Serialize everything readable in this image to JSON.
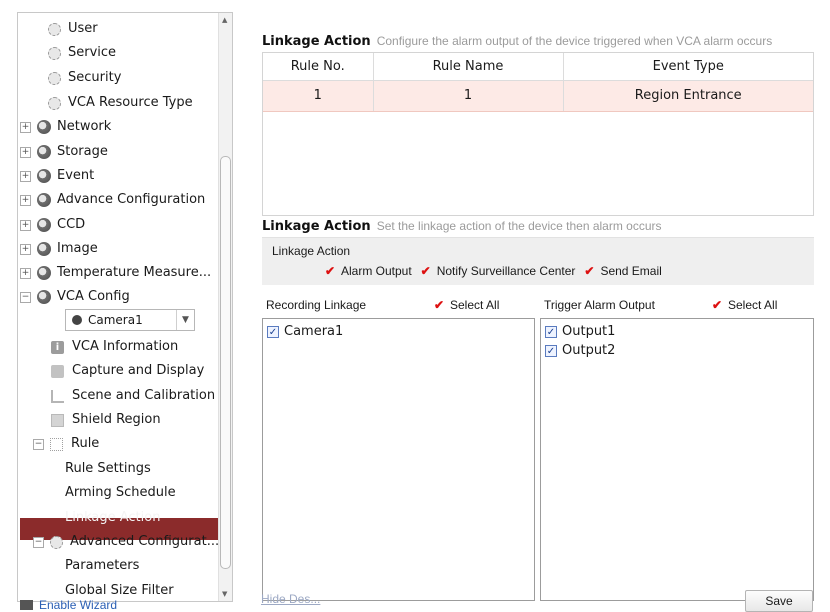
{
  "tree": {
    "items": [
      {
        "label": "User",
        "icon": "gear-icon"
      },
      {
        "label": "Service",
        "icon": "gear-icon"
      },
      {
        "label": "Security",
        "icon": "gear-icon"
      },
      {
        "label": "VCA Resource Type",
        "icon": "gear-icon"
      },
      {
        "label": "Network",
        "icon": "globe-icon",
        "expander": "+"
      },
      {
        "label": "Storage",
        "icon": "globe-icon",
        "expander": "+"
      },
      {
        "label": "Event",
        "icon": "globe-icon",
        "expander": "+"
      },
      {
        "label": "Advance Configuration",
        "icon": "globe-icon",
        "expander": "+"
      },
      {
        "label": "CCD",
        "icon": "globe-icon",
        "expander": "+"
      },
      {
        "label": "Image",
        "icon": "globe-icon",
        "expander": "+"
      },
      {
        "label": "Temperature Measure...",
        "icon": "globe-icon",
        "expander": "+"
      },
      {
        "label": "VCA Config",
        "icon": "globe-icon",
        "expander": "−"
      }
    ],
    "camera_select": {
      "value": "Camera1"
    },
    "sub_items": [
      {
        "label": "VCA Information"
      },
      {
        "label": "Capture and Display"
      },
      {
        "label": "Scene and Calibration"
      },
      {
        "label": "Shield Region"
      }
    ],
    "rule": {
      "label": "Rule",
      "expander": "−"
    },
    "rule_children": [
      {
        "label": "Rule Settings"
      },
      {
        "label": "Arming Schedule"
      },
      {
        "label": "Linkage Action",
        "selected": true
      }
    ],
    "advanced": {
      "label": "Advanced Configurat...",
      "expander": "−"
    },
    "advanced_children": [
      {
        "label": "Parameters"
      },
      {
        "label": "Global Size Filter"
      }
    ],
    "selected_color": "#8b2b2b"
  },
  "enable_wizard": "Enable Wizard",
  "linkage_top": {
    "title": "Linkage Action",
    "desc": "Configure the alarm output of the device triggered when VCA alarm occurs"
  },
  "rules_table": {
    "headers": [
      "Rule No.",
      "Rule Name",
      "Event Type"
    ],
    "rows": [
      [
        "1",
        "1",
        "Region Entrance"
      ]
    ]
  },
  "linkage_bottom": {
    "title": "Linkage Action",
    "desc": "Set the linkage action of the device then alarm occurs",
    "group_label": "Linkage Action",
    "options": [
      "Alarm Output",
      "Notify Surveillance Center",
      "Send Email"
    ]
  },
  "recording": {
    "title": "Recording Linkage",
    "select_all": "Select All",
    "items": [
      "Camera1"
    ]
  },
  "trigger": {
    "title": "Trigger Alarm Output",
    "select_all": "Select All",
    "items": [
      "Output1",
      "Output2"
    ]
  },
  "footer": {
    "hide_desc": "Hide Des...",
    "save": "Save"
  }
}
